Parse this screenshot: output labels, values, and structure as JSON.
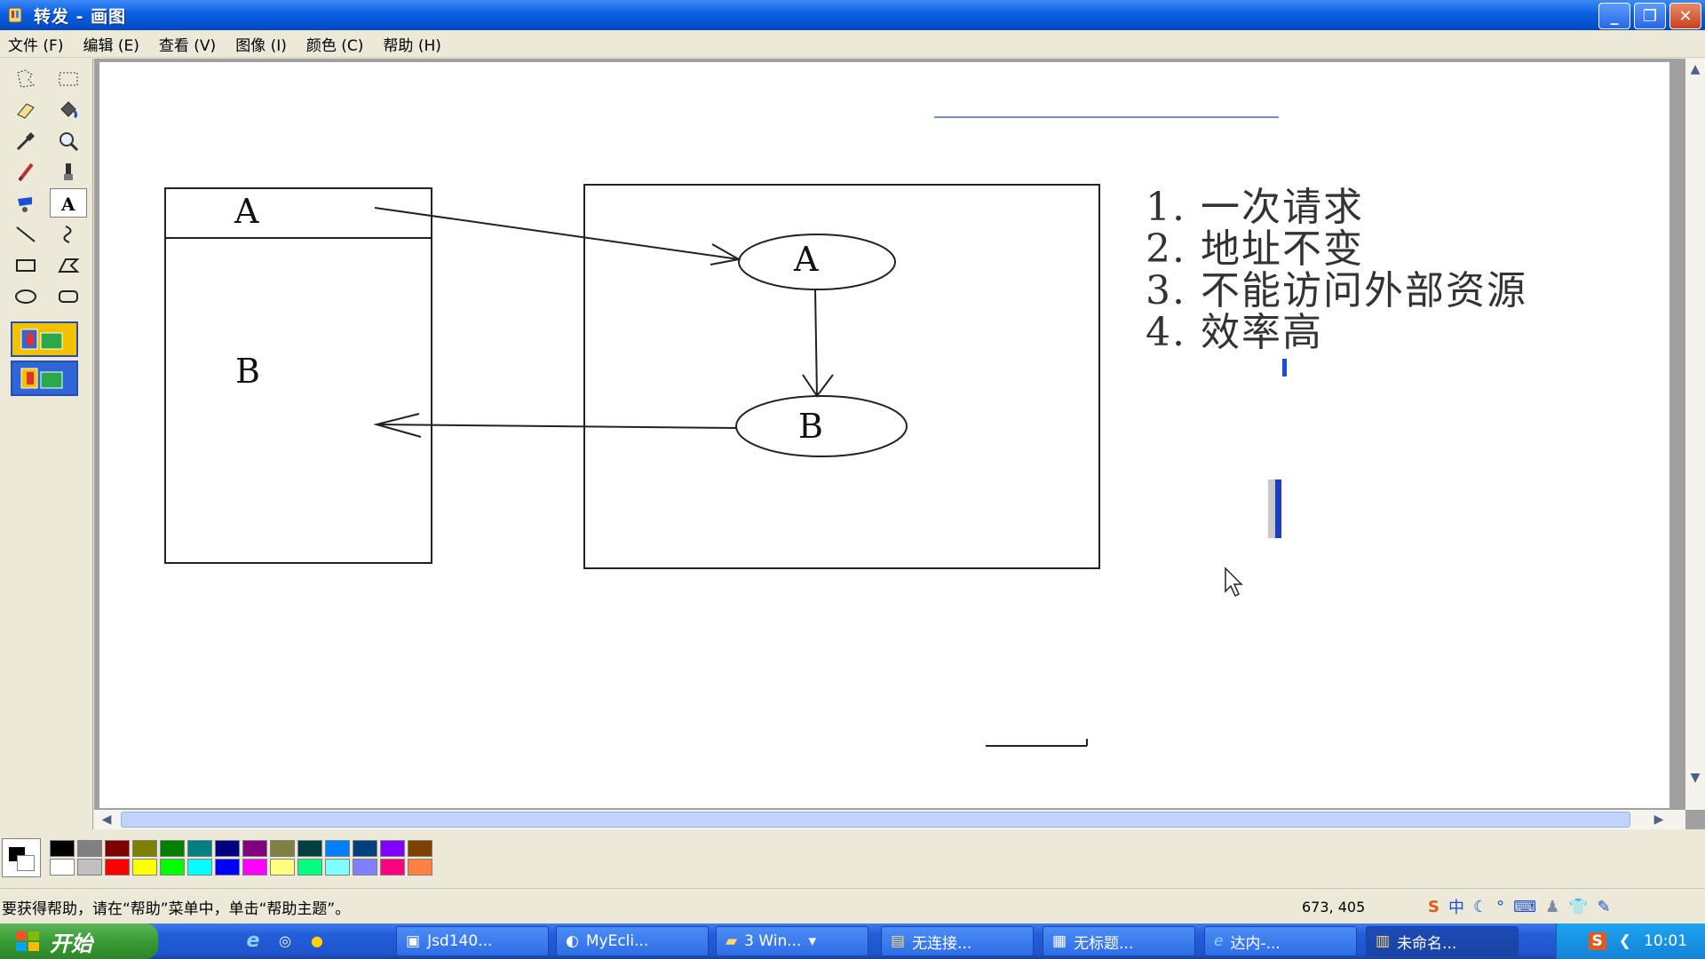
{
  "window": {
    "title": "转发 - 画图",
    "app_icon": "paint-icon",
    "controls": [
      "minimize-icon",
      "restore-icon",
      "close-icon"
    ]
  },
  "menu": {
    "items": [
      "文件 (F)",
      "编辑 (E)",
      "查看 (V)",
      "图像 (I)",
      "颜色 (C)",
      "帮助 (H)"
    ]
  },
  "tools": [
    {
      "name": "free-select-icon",
      "pressed": false
    },
    {
      "name": "rect-select-icon",
      "pressed": false
    },
    {
      "name": "eraser-icon",
      "pressed": false
    },
    {
      "name": "fill-bucket-icon",
      "pressed": false
    },
    {
      "name": "color-picker-icon",
      "pressed": false
    },
    {
      "name": "magnifier-icon",
      "pressed": false
    },
    {
      "name": "pencil-icon",
      "pressed": false
    },
    {
      "name": "brush-icon",
      "pressed": false
    },
    {
      "name": "airbrush-icon",
      "pressed": false
    },
    {
      "name": "text-icon",
      "pressed": true
    },
    {
      "name": "line-icon",
      "pressed": false
    },
    {
      "name": "curve-icon",
      "pressed": false
    },
    {
      "name": "rectangle-icon",
      "pressed": false
    },
    {
      "name": "polygon-icon",
      "pressed": false
    },
    {
      "name": "ellipse-icon",
      "pressed": false
    },
    {
      "name": "rounded-rect-icon",
      "pressed": false
    }
  ],
  "canvas": {
    "left_box_top_label": "A",
    "left_box_bottom_label": "B",
    "node_a_label": "A",
    "node_b_label": "B",
    "list": [
      "1. 一次请求",
      "2. 地址不变",
      "3. 不能访问外部资源",
      "4. 效率高"
    ]
  },
  "palette": {
    "foreground": "#000000",
    "background": "#ffffff",
    "colors": [
      "#000000",
      "#808080",
      "#800000",
      "#808000",
      "#008000",
      "#008080",
      "#000080",
      "#800080",
      "#808040",
      "#004040",
      "#0080ff",
      "#004080",
      "#8000ff",
      "#804000",
      "#ffffff",
      "#c0c0c0",
      "#ff0000",
      "#ffff00",
      "#00ff00",
      "#00ffff",
      "#0000ff",
      "#ff00ff",
      "#ffff80",
      "#00ff80",
      "#80ffff",
      "#8080ff",
      "#ff0080",
      "#ff8040"
    ]
  },
  "status": {
    "help_text": "要获得帮助，请在“帮助”菜单中，单击“帮助主题”。",
    "coords": "673, 405"
  },
  "taskbar": {
    "start_label": "开始",
    "tasks": [
      "Jsd140...",
      "MyEcli...",
      "3 Win...",
      "无连接...",
      "无标题...",
      "达内-...",
      "未命名..."
    ],
    "clock": "10:01"
  }
}
